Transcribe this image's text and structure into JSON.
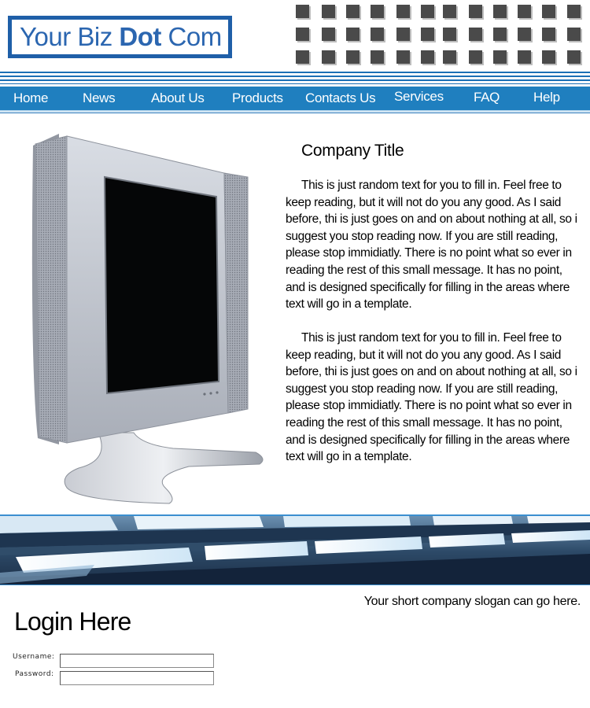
{
  "header": {
    "logo": {
      "part1": "Your Biz ",
      "part2": "Dot",
      "part3": " Com"
    }
  },
  "nav": {
    "items": [
      "Home",
      "News",
      "About Us",
      "Products",
      "Contacts Us",
      "Services",
      "FAQ",
      "Help"
    ]
  },
  "main": {
    "title": "Company Title",
    "paragraphs": [
      "This is just random text for you to fill in.  Feel free to keep reading, but it will not do you any good.  As I said before, thi is just goes on and on about nothing at all, so i suggest you stop reading now.  If you are still reading, please stop immidiatly.  There is no point what so ever in reading the rest of this small message.  It has no point, and is designed specifically for filling in the areas where text will go in a template.",
      "This is just random text for you to fill in.  Feel free to keep reading, but it will not do you any good.  As I said before, thi is just goes on and on about nothing at all, so i suggest you stop reading now.  If you are still reading, please stop immidiatly.  There is no point what so ever in reading the rest of this small message.  It has no point, and is designed specifically for filling in the areas where text will go in a template."
    ]
  },
  "slogan": "Your short company slogan can go here.",
  "login": {
    "title": "Login Here",
    "username_label": "Username:",
    "password_label": "Password:",
    "username_value": "",
    "password_value": ""
  },
  "colors": {
    "brand_blue": "#1f5fa8",
    "nav_blue": "#1f7fbf",
    "square_gray": "#4a4a4a"
  }
}
